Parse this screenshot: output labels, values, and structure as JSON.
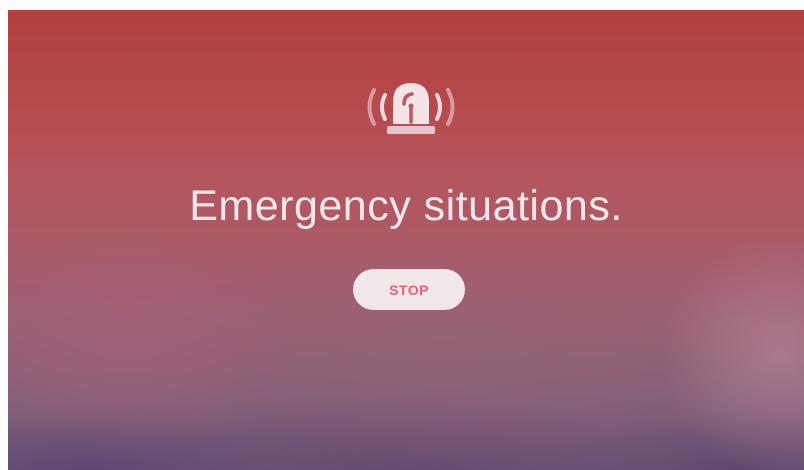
{
  "screen": {
    "title": "Emergency situations.",
    "stop_label": "STOP",
    "icon": "alarm-siren-icon"
  },
  "colors": {
    "background_top": "#b3403e",
    "background_bottom": "#6e5577",
    "text": "#f4e6ea",
    "button_bg": "#f1e6ea",
    "button_text": "#e86372"
  }
}
